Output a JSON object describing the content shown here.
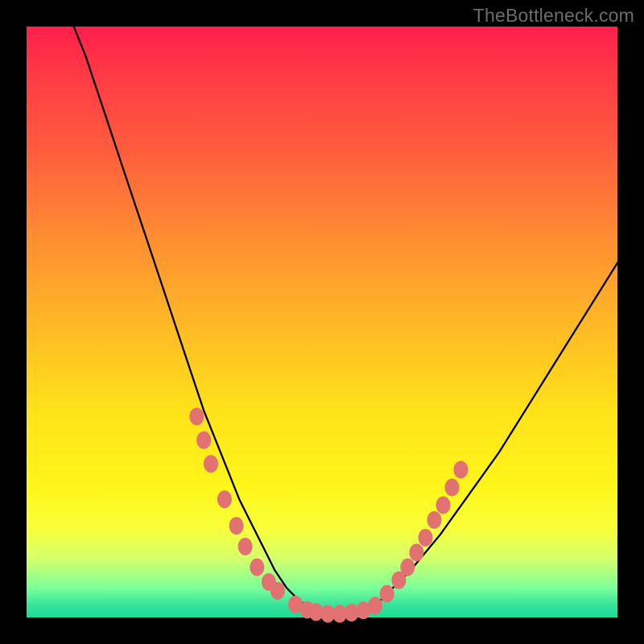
{
  "watermark": "TheBottleneck.com",
  "chart_data": {
    "type": "line",
    "title": "",
    "xlabel": "",
    "ylabel": "",
    "xlim": [
      0,
      100
    ],
    "ylim": [
      0,
      100
    ],
    "series": [
      {
        "name": "bottleneck-curve",
        "x": [
          8,
          10,
          12,
          14,
          16,
          18,
          20,
          22,
          24,
          26,
          28,
          30,
          32,
          34,
          36,
          38,
          40,
          42,
          44,
          46,
          48,
          50,
          52,
          54,
          56,
          58,
          60,
          62,
          65,
          70,
          75,
          80,
          85,
          90,
          95,
          100
        ],
        "values": [
          100,
          95,
          89,
          83,
          77,
          71,
          65,
          59,
          53,
          47,
          41,
          35,
          30,
          25,
          20,
          16,
          12,
          8,
          5,
          3,
          1.5,
          0.8,
          0.5,
          0.5,
          0.8,
          1.5,
          3,
          5,
          8,
          14,
          21,
          28,
          36,
          44,
          52,
          60
        ]
      }
    ],
    "markers": {
      "name": "highlighted-points",
      "points": [
        {
          "x": 28.8,
          "y": 34
        },
        {
          "x": 30.0,
          "y": 30
        },
        {
          "x": 31.2,
          "y": 26
        },
        {
          "x": 33.5,
          "y": 20
        },
        {
          "x": 35.5,
          "y": 15.5
        },
        {
          "x": 37.0,
          "y": 12
        },
        {
          "x": 39.0,
          "y": 8.5
        },
        {
          "x": 41.0,
          "y": 6
        },
        {
          "x": 42.5,
          "y": 4.5
        },
        {
          "x": 45.5,
          "y": 2.2
        },
        {
          "x": 47.5,
          "y": 1.3
        },
        {
          "x": 49.0,
          "y": 0.9
        },
        {
          "x": 51.0,
          "y": 0.6
        },
        {
          "x": 53.0,
          "y": 0.6
        },
        {
          "x": 55.0,
          "y": 0.8
        },
        {
          "x": 57.0,
          "y": 1.2
        },
        {
          "x": 59.0,
          "y": 2.0
        },
        {
          "x": 61.0,
          "y": 4.0
        },
        {
          "x": 63.0,
          "y": 6.3
        },
        {
          "x": 64.5,
          "y": 8.5
        },
        {
          "x": 66.0,
          "y": 11
        },
        {
          "x": 67.5,
          "y": 13.5
        },
        {
          "x": 69.0,
          "y": 16.5
        },
        {
          "x": 70.5,
          "y": 19
        },
        {
          "x": 72.0,
          "y": 22
        },
        {
          "x": 73.5,
          "y": 25
        }
      ]
    },
    "background_gradient": {
      "top": "#ff1f4b",
      "mid": "#ffe21a",
      "bottom": "#1fd99a"
    }
  }
}
